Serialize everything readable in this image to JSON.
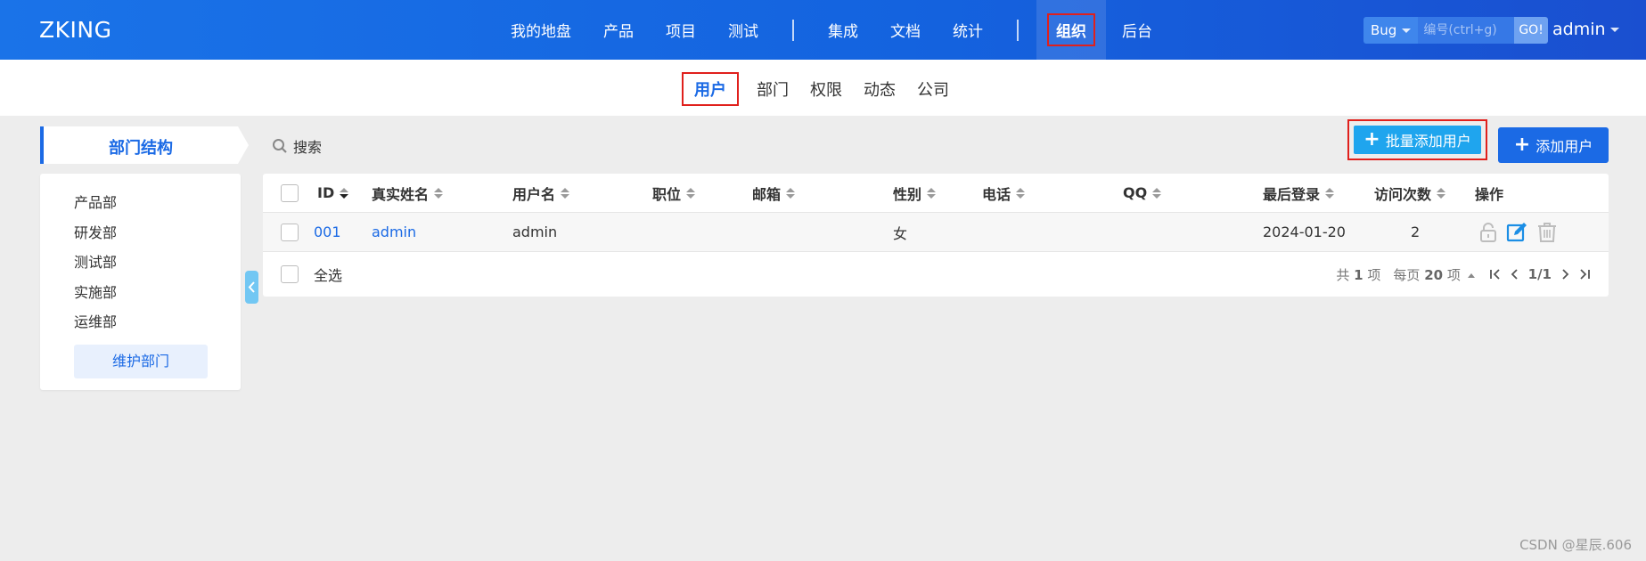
{
  "app": {
    "brand": "ZKING"
  },
  "topnav": {
    "items": [
      "我的地盘",
      "产品",
      "项目",
      "测试",
      "集成",
      "文档",
      "统计",
      "组织",
      "后台"
    ],
    "active": "组织"
  },
  "search": {
    "type": "Bug",
    "placeholder": "编号(ctrl+g)",
    "go": "GO!"
  },
  "user": {
    "name": "admin"
  },
  "subnav": {
    "items": [
      "用户",
      "部门",
      "权限",
      "动态",
      "公司"
    ],
    "active": "用户"
  },
  "sidebar": {
    "title": "部门结构",
    "departments": [
      "产品部",
      "研发部",
      "测试部",
      "实施部",
      "运维部"
    ],
    "maintain_button": "维护部门"
  },
  "toolbar": {
    "search_label": "搜索",
    "batch_add_label": "批量添加用户",
    "add_label": "添加用户"
  },
  "table": {
    "headers": [
      "ID",
      "真实姓名",
      "用户名",
      "职位",
      "邮箱",
      "性别",
      "电话",
      "QQ",
      "最后登录",
      "访问次数",
      "操作"
    ],
    "rows": [
      {
        "id": "001",
        "realname": "admin",
        "username": "admin",
        "position": "",
        "email": "",
        "gender": "女",
        "phone": "",
        "qq": "",
        "last_login": "2024-01-20",
        "visits": "2"
      }
    ],
    "select_all": "全选"
  },
  "pager": {
    "total_prefix": "共",
    "total": "1",
    "total_suffix": "项",
    "per_page_prefix": "每页",
    "per_page": "20",
    "per_page_suffix": "项",
    "page": "1/1"
  },
  "watermark": "CSDN @星辰.606",
  "colors": {
    "primary": "#1b6ae5",
    "highlight": "#e0201c",
    "batch_button": "#1fa5ee"
  },
  "icons": [
    "search-icon",
    "lock-icon",
    "edit-icon",
    "trash-icon",
    "chevron-left-icon",
    "caret-down-icon",
    "first-page-icon",
    "prev-page-icon",
    "next-page-icon",
    "last-page-icon"
  ]
}
